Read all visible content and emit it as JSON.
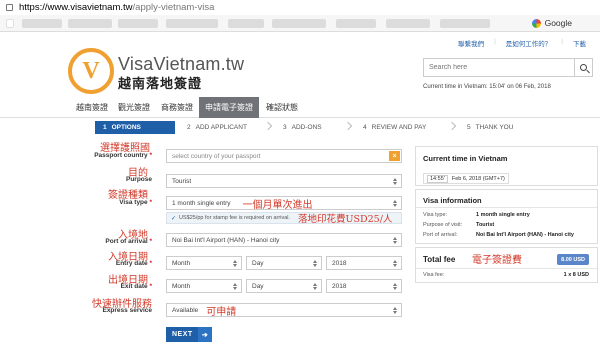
{
  "browser": {
    "url_host": "https://www.visavietnam.tw",
    "url_path": "/apply-vietnam-visa",
    "bookmark_google": "Google"
  },
  "toplinks": {
    "contact": "聯繫我們",
    "how_it_works": "是如何工作的？",
    "download": "下載"
  },
  "header": {
    "brand": "VisaVietnam.tw",
    "brand_cn": "越南落地簽證",
    "logo_letter": "V",
    "search_placeholder": "Search here",
    "current_time_text": "Current time in Vietnam: 15:04' on 06 Feb, 2018"
  },
  "nav": {
    "items": [
      "越南簽證",
      "觀光簽證",
      "商務簽證",
      "申請電子簽證",
      "確認狀態"
    ],
    "active_index": 3
  },
  "steps": [
    {
      "num": "1",
      "label": "OPTIONS"
    },
    {
      "num": "2",
      "label": "ADD APPLICANT"
    },
    {
      "num": "3",
      "label": "ADD-ONS"
    },
    {
      "num": "4",
      "label": "REVIEW AND PAY"
    },
    {
      "num": "5",
      "label": "THANK YOU"
    }
  ],
  "form": {
    "passport_country": {
      "label": "Passport country",
      "annotation": "選擇護照國",
      "placeholder": "select country of your passport"
    },
    "purpose": {
      "label": "Purpose",
      "annotation": "目的",
      "value": "Tourist"
    },
    "visa_type": {
      "label": "Visa type",
      "annotation": "簽證種類",
      "value": "1 month single entry",
      "value_annotation": "一個月單次進出"
    },
    "stamp_note": "US$25/pp for stamp fee is required on arrival.",
    "stamp_annotation": "落地印花費USD25/人",
    "port_of_arrival": {
      "label": "Port of arrival",
      "annotation": "入境地",
      "value": "Noi Bai Int'l Airport (HAN) - Hanoi city"
    },
    "entry_date": {
      "label": "Entry date",
      "annotation": "入境日期",
      "month": "Month",
      "day": "Day",
      "year": "2018"
    },
    "exit_date": {
      "label": "Exit date",
      "annotation": "出境日期",
      "month": "Month",
      "day": "Day",
      "year": "2018"
    },
    "express_service": {
      "label": "Express service",
      "annotation": "快速辦件服務",
      "value": "Available",
      "value_annotation": "可申請"
    },
    "next_button": "NEXT",
    "required_mark": "*"
  },
  "sidebar": {
    "current_time": {
      "title": "Current time in Vietnam",
      "clock": "14:55'",
      "date": "Feb 6, 2018 (GMT+7)"
    },
    "visa_info": {
      "title": "Visa information",
      "rows": [
        {
          "label": "Visa type:",
          "value": "1 month single entry"
        },
        {
          "label": "Purpose of visit:",
          "value": "Tourist"
        },
        {
          "label": "Port of arrival:",
          "value": "Noi Bai Int'l Airport (HAN) - Hanoi city"
        }
      ]
    },
    "total_fee": {
      "title": "Total fee",
      "annotation": "電子簽證費",
      "badge": "8.00 USD",
      "row_label": "Visa fee:",
      "row_value": "1 x 8 USD"
    }
  },
  "colors": {
    "primary": "#1f5fa8",
    "accent": "#f0a030",
    "annotation": "#d33a2a",
    "nav_active": "#6f7277"
  }
}
